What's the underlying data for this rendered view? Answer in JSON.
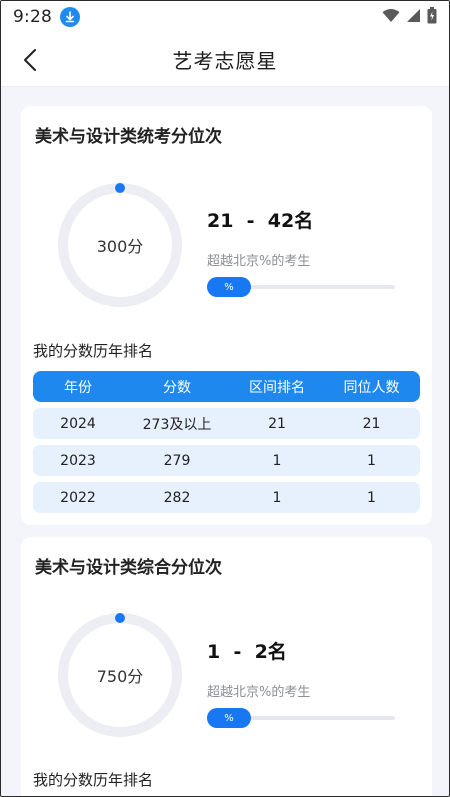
{
  "status_bar": {
    "time": "9:28"
  },
  "app_bar": {
    "title": "艺考志愿星"
  },
  "cards": [
    {
      "title": "美术与设计类统考分位次",
      "score": "300分",
      "rank_range": "21  -  42名",
      "exceed_text": "超越北京%的考生",
      "progress_label": "%",
      "history_label": "我的分数历年排名",
      "table": {
        "headers": [
          "年份",
          "分数",
          "区间排名",
          "同位人数"
        ],
        "rows": [
          [
            "2024",
            "273及以上",
            "21",
            "21"
          ],
          [
            "2023",
            "279",
            "1",
            "1"
          ],
          [
            "2022",
            "282",
            "1",
            "1"
          ]
        ]
      }
    },
    {
      "title": "美术与设计类综合分位次",
      "score": "750分",
      "rank_range": "1  -  2名",
      "exceed_text": "超越北京%的考生",
      "progress_label": "%",
      "history_label": "我的分数历年排名"
    }
  ],
  "colors": {
    "accent": "#1e88ee",
    "row_bg": "#e6f1fd",
    "ring_track": "#eceef3",
    "download_badge": "#1e8bf0"
  },
  "icons": [
    "download-icon",
    "wifi-icon",
    "signal-icon",
    "battery-icon",
    "back-arrow-icon"
  ]
}
